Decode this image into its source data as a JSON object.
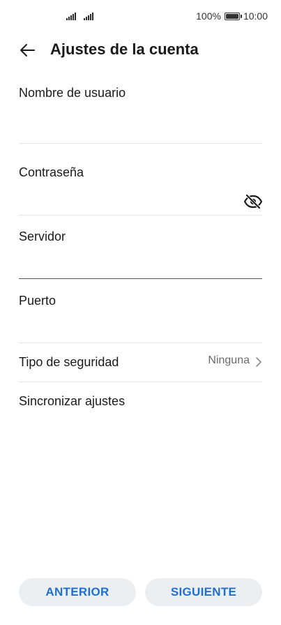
{
  "status_bar": {
    "battery_percent": "100%",
    "time": "10:00",
    "icons": [
      "signal-icon",
      "signal-icon",
      "battery-icon"
    ]
  },
  "header": {
    "back_icon": "arrow-left-icon",
    "title": "Ajustes de la cuenta"
  },
  "form": {
    "username": {
      "label": "Nombre de usuario",
      "value": ""
    },
    "password": {
      "label": "Contraseña",
      "value": "",
      "toggle_icon": "eye-off-icon"
    },
    "server": {
      "label": "Servidor",
      "value": ""
    },
    "port": {
      "label": "Puerto",
      "value": ""
    }
  },
  "security": {
    "label": "Tipo de seguridad",
    "value": "Ninguna",
    "icon": "chevron-right-icon"
  },
  "sync": {
    "label": "Sincronizar ajustes"
  },
  "buttons": {
    "previous": "ANTERIOR",
    "next": "SIGUIENTE"
  },
  "colors": {
    "accent": "#1f6fd1",
    "button_bg": "#eceff1",
    "divider": "#e6e6e6",
    "active_divider": "#555555"
  }
}
